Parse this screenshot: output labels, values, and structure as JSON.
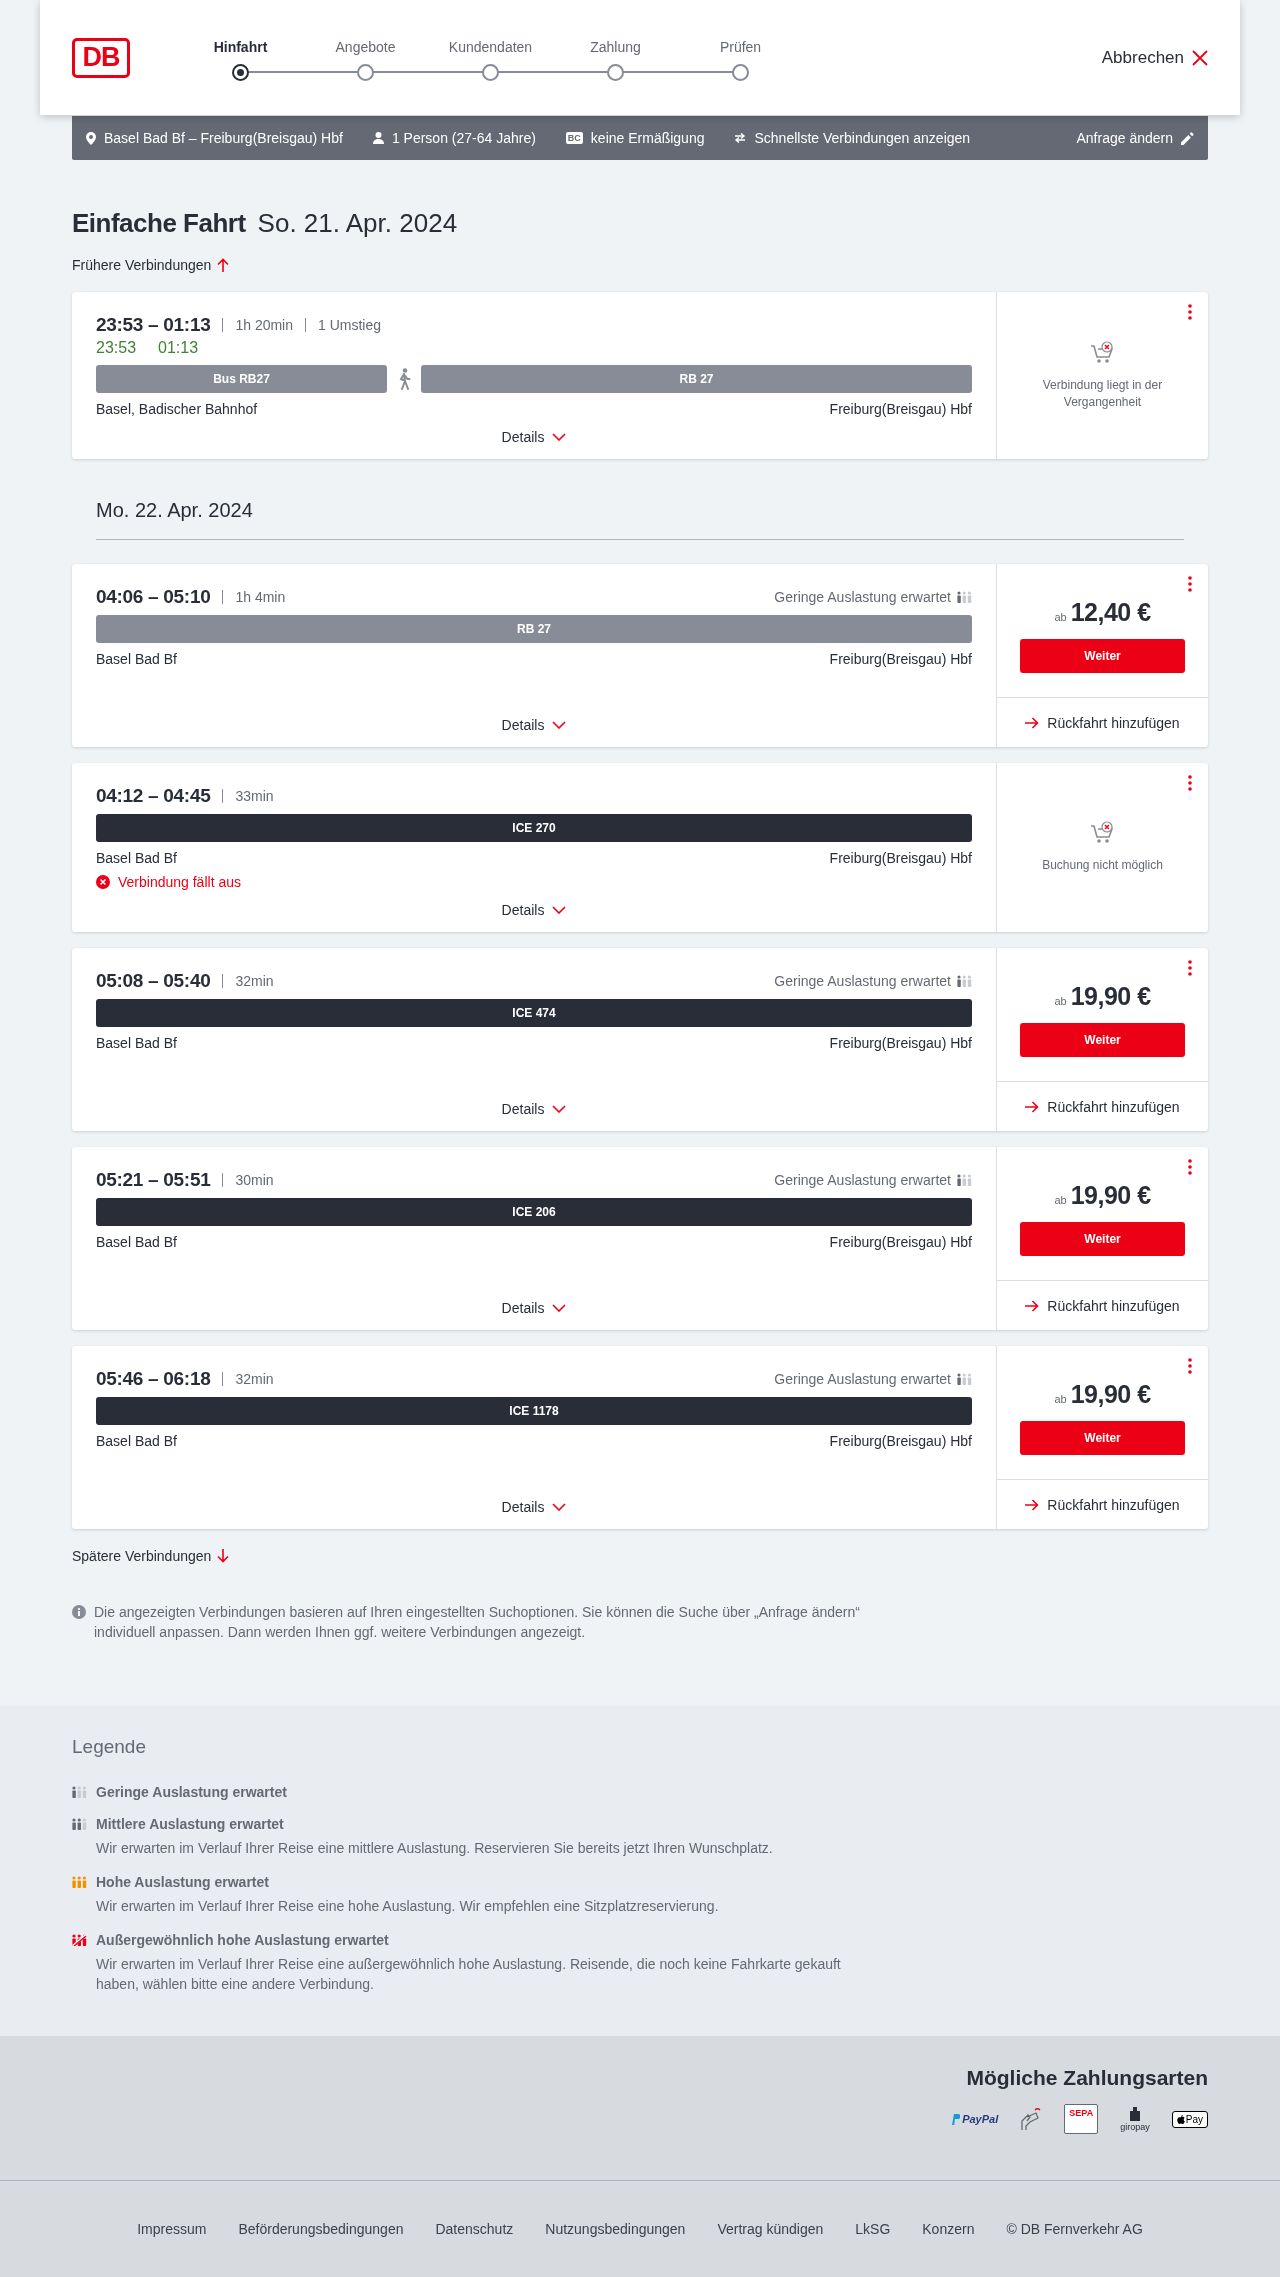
{
  "header": {
    "logo": "DB",
    "steps": [
      {
        "label": "Hinfahrt",
        "selected": true
      },
      {
        "label": "Angebote",
        "selected": false
      },
      {
        "label": "Kundendaten",
        "selected": false
      },
      {
        "label": "Zahlung",
        "selected": false
      },
      {
        "label": "Prüfen",
        "selected": false
      }
    ],
    "cancel": "Abbrechen"
  },
  "search_summary": {
    "route": "Basel Bad Bf – Freiburg(Breisgau) Hbf",
    "travellers": "1 Person (27-64 Jahre)",
    "discount_badge": "BC",
    "discount": "keine Ermäßigung",
    "option": "Schnellste Verbindungen anzeigen",
    "edit": "Anfrage ändern"
  },
  "heading": {
    "title": "Einfache Fahrt",
    "date": "So. 21. Apr. 2024"
  },
  "earlier": "Frühere Verbindungen",
  "timeline": [
    {
      "kind": "connection",
      "times": "23:53 – 01:13",
      "real_times": [
        "23:53",
        "01:13"
      ],
      "duration": "1h 20min",
      "transfers": "1 Umstieg",
      "segments": [
        {
          "kind": "bus",
          "label": "Bus RB27"
        },
        {
          "kind": "walk"
        },
        {
          "kind": "regional",
          "label": "RB 27"
        }
      ],
      "from": "Basel, Badischer Bahnhof",
      "to": "Freiburg(Breisgau) Hbf",
      "details": "Details",
      "offer": {
        "kind": "unavailable",
        "text": "Verbindung liegt in der Vergangenheit"
      }
    },
    {
      "kind": "date",
      "label": "Mo. 22. Apr. 2024"
    },
    {
      "kind": "connection",
      "times": "04:06 – 05:10",
      "duration": "1h 4min",
      "occupancy": {
        "text": "Geringe Auslastung erwartet",
        "kind": "low"
      },
      "segments": [
        {
          "kind": "regional",
          "label": "RB 27"
        }
      ],
      "from": "Basel Bad Bf",
      "to": "Freiburg(Breisgau) Hbf",
      "details": "Details",
      "offer": {
        "kind": "price",
        "prefix": "ab",
        "price": "12,40 €",
        "button": "Weiter",
        "return": "Rückfahrt hinzufügen"
      }
    },
    {
      "kind": "connection",
      "times": "04:12 – 04:45",
      "duration": "33min",
      "segments": [
        {
          "kind": "longdistance",
          "label": "ICE 270"
        }
      ],
      "from": "Basel Bad Bf",
      "to": "Freiburg(Breisgau) Hbf",
      "cancelled": "Verbindung fällt aus",
      "details": "Details",
      "offer": {
        "kind": "unavailable",
        "text": "Buchung nicht möglich"
      }
    },
    {
      "kind": "connection",
      "times": "05:08 – 05:40",
      "duration": "32min",
      "occupancy": {
        "text": "Geringe Auslastung erwartet",
        "kind": "low"
      },
      "segments": [
        {
          "kind": "longdistance",
          "label": "ICE 474"
        }
      ],
      "from": "Basel Bad Bf",
      "to": "Freiburg(Breisgau) Hbf",
      "details": "Details",
      "offer": {
        "kind": "price",
        "prefix": "ab",
        "price": "19,90 €",
        "button": "Weiter",
        "return": "Rückfahrt hinzufügen"
      }
    },
    {
      "kind": "connection",
      "times": "05:21 – 05:51",
      "duration": "30min",
      "occupancy": {
        "text": "Geringe Auslastung erwartet",
        "kind": "low"
      },
      "segments": [
        {
          "kind": "longdistance",
          "label": "ICE 206"
        }
      ],
      "from": "Basel Bad Bf",
      "to": "Freiburg(Breisgau) Hbf",
      "details": "Details",
      "offer": {
        "kind": "price",
        "prefix": "ab",
        "price": "19,90 €",
        "button": "Weiter",
        "return": "Rückfahrt hinzufügen"
      }
    },
    {
      "kind": "connection",
      "times": "05:46 – 06:18",
      "duration": "32min",
      "occupancy": {
        "text": "Geringe Auslastung erwartet",
        "kind": "low"
      },
      "segments": [
        {
          "kind": "longdistance",
          "label": "ICE 1178"
        }
      ],
      "from": "Basel Bad Bf",
      "to": "Freiburg(Breisgau) Hbf",
      "details": "Details",
      "offer": {
        "kind": "price",
        "prefix": "ab",
        "price": "19,90 €",
        "button": "Weiter",
        "return": "Rückfahrt hinzufügen"
      }
    }
  ],
  "later": "Spätere Verbindungen",
  "info": "Die angezeigten Verbindungen basieren auf Ihren eingestellten Suchoptionen. Sie können die Suche über „Anfrage ändern“ individuell anpassen. Dann werden Ihnen ggf. weitere Verbindungen angezeigt.",
  "legend": {
    "title": "Legende",
    "items": [
      {
        "kind": "low",
        "title": "Geringe Auslastung erwartet"
      },
      {
        "kind": "medium",
        "title": "Mittlere Auslastung erwartet",
        "text": "Wir erwarten im Verlauf Ihrer Reise eine mittlere Auslastung. Reservieren Sie bereits jetzt Ihren Wunschplatz."
      },
      {
        "kind": "high",
        "title": "Hohe Auslastung erwartet",
        "text": "Wir erwarten im Verlauf Ihrer Reise eine hohe Auslastung. Wir empfehlen eine Sitzplatzreservierung."
      },
      {
        "kind": "exceptional",
        "title": "Außergewöhnlich hohe Auslastung erwartet",
        "text": "Wir erwarten im Verlauf Ihrer Reise eine außergewöhnlich hohe Auslastung. Reisende, die noch keine Fahrkarte gekauft haben, wählen bitte eine andere Verbindung."
      }
    ]
  },
  "payment": {
    "title": "Mögliche Zahlungsarten",
    "methods": [
      {
        "kind": "paypal",
        "label": "PayPal"
      },
      {
        "kind": "card"
      },
      {
        "kind": "sepa",
        "label": "SEPA"
      },
      {
        "kind": "giropay",
        "label": "giropay"
      },
      {
        "kind": "applepay",
        "label": "Pay"
      }
    ]
  },
  "footer_links": [
    "Impressum",
    "Beförderungsbedingungen",
    "Datenschutz",
    "Nutzungsbedingungen",
    "Vertrag kündigen",
    "LkSG",
    "Konzern",
    "© DB Fernverkehr AG"
  ]
}
